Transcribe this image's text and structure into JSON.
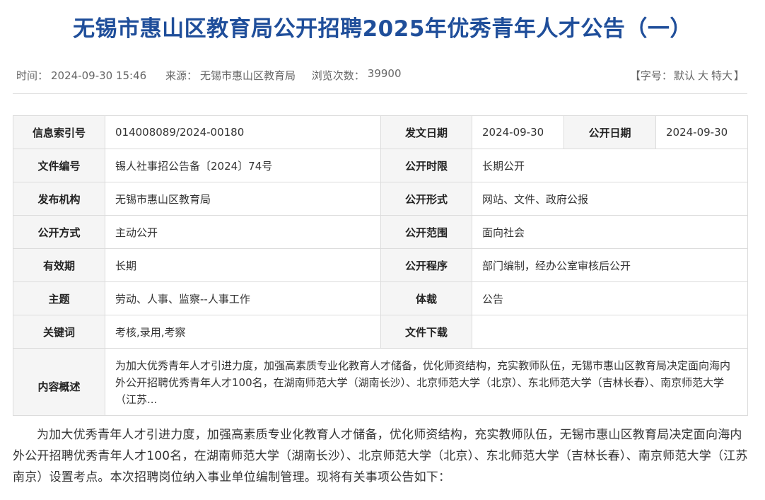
{
  "title": "无锡市惠山区教育局公开招聘2025年优秀青年人才公告（一）",
  "meta": {
    "time_label": "时间：",
    "time_value": "2024-09-30 15:46",
    "source_label": "来源：",
    "source_value": "无锡市惠山区教育局",
    "views_label": "浏览次数：",
    "views_value": "39900",
    "fontsize_prefix": "【字号：",
    "fontsize_default": "默认",
    "fontsize_large": "大",
    "fontsize_xlarge": "特大",
    "fontsize_suffix": "】"
  },
  "info": {
    "index_label": "信息索引号",
    "index_value": "014008089/2024-00180",
    "issue_date_label": "发文日期",
    "issue_date_value": "2024-09-30",
    "public_date_label": "公开日期",
    "public_date_value": "2024-09-30",
    "doc_no_label": "文件编号",
    "doc_no_value": "锡人社事招公告备〔2024〕74号",
    "period_label": "公开时限",
    "period_value": "长期公开",
    "org_label": "发布机构",
    "org_value": "无锡市惠山区教育局",
    "form_label": "公开形式",
    "form_value": "网站、文件、政府公报",
    "method_label": "公开方式",
    "method_value": "主动公开",
    "scope_label": "公开范围",
    "scope_value": "面向社会",
    "validity_label": "有效期",
    "validity_value": "长期",
    "procedure_label": "公开程序",
    "procedure_value": "部门编制，经办公室审核后公开",
    "subject_label": "主题",
    "subject_value": "劳动、人事、监察--人事工作",
    "genre_label": "体裁",
    "genre_value": "公告",
    "keywords_label": "关键词",
    "keywords_value": "考核,录用,考察",
    "download_label": "文件下载",
    "download_value": "",
    "summary_label": "内容概述",
    "summary_value": "为加大优秀青年人才引进力度，加强高素质专业化教育人才储备，优化师资结构，充实教师队伍，无锡市惠山区教育局决定面向海内外公开招聘优秀青年人才100名，在湖南师范大学（湖南长沙）、北京师范大学（北京）、东北师范大学（吉林长春）、南京师范大学（江苏..."
  },
  "body": {
    "paragraph1": "为加大优秀青年人才引进力度，加强高素质专业化教育人才储备，优化师资结构，充实教师队伍，无锡市惠山区教育局决定面向海内外公开招聘优秀青年人才100名，在湖南师范大学（湖南长沙）、北京师范大学（北京）、东北师范大学（吉林长春）、南京师范大学（江苏南京）设置考点。本次招聘岗位纳入事业单位编制管理。现将有关事项公告如下："
  },
  "colors": {
    "title": "#1f4e9a",
    "label_bg": "#f5f5f5",
    "border": "#dcdcdc",
    "meta_text": "#666666"
  }
}
